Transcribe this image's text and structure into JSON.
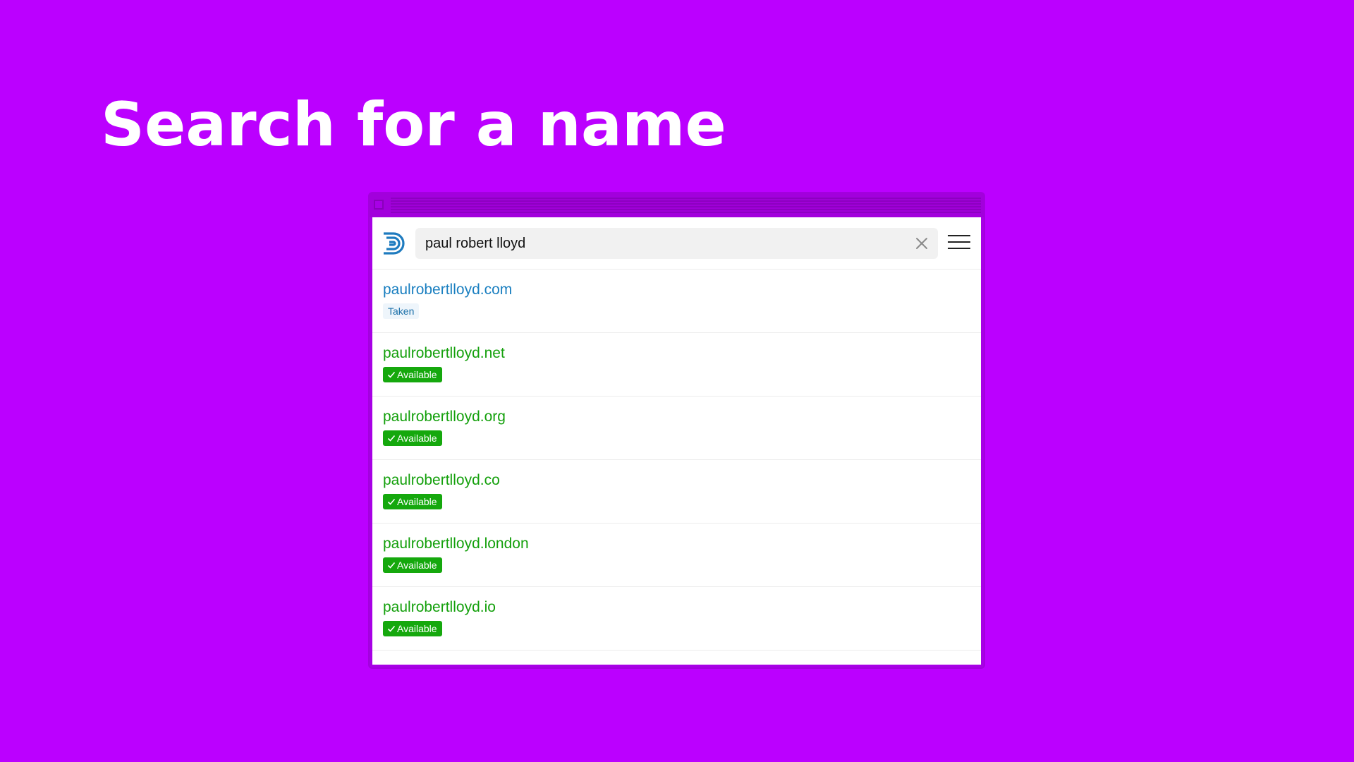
{
  "headline": "Search for a name",
  "search": {
    "value": "paul robert lloyd"
  },
  "icons": {
    "logo": "logo-icon",
    "clear": "close-icon",
    "menu": "hamburger-menu-icon",
    "check": "check-icon"
  },
  "colors": {
    "background": "#bb00ff",
    "taken_link": "#1a7fc0",
    "available_link": "#14a00c",
    "available_badge": "#15a80d",
    "logo": "#1e7bbf"
  },
  "results": [
    {
      "domain": "paulrobertlloyd.com",
      "status": "taken",
      "badge": "Taken"
    },
    {
      "domain": "paulrobertlloyd.net",
      "status": "available",
      "badge": "Available"
    },
    {
      "domain": "paulrobertlloyd.org",
      "status": "available",
      "badge": "Available"
    },
    {
      "domain": "paulrobertlloyd.co",
      "status": "available",
      "badge": "Available"
    },
    {
      "domain": "paulrobertlloyd.london",
      "status": "available",
      "badge": "Available"
    },
    {
      "domain": "paulrobertlloyd.io",
      "status": "available",
      "badge": "Available"
    }
  ]
}
